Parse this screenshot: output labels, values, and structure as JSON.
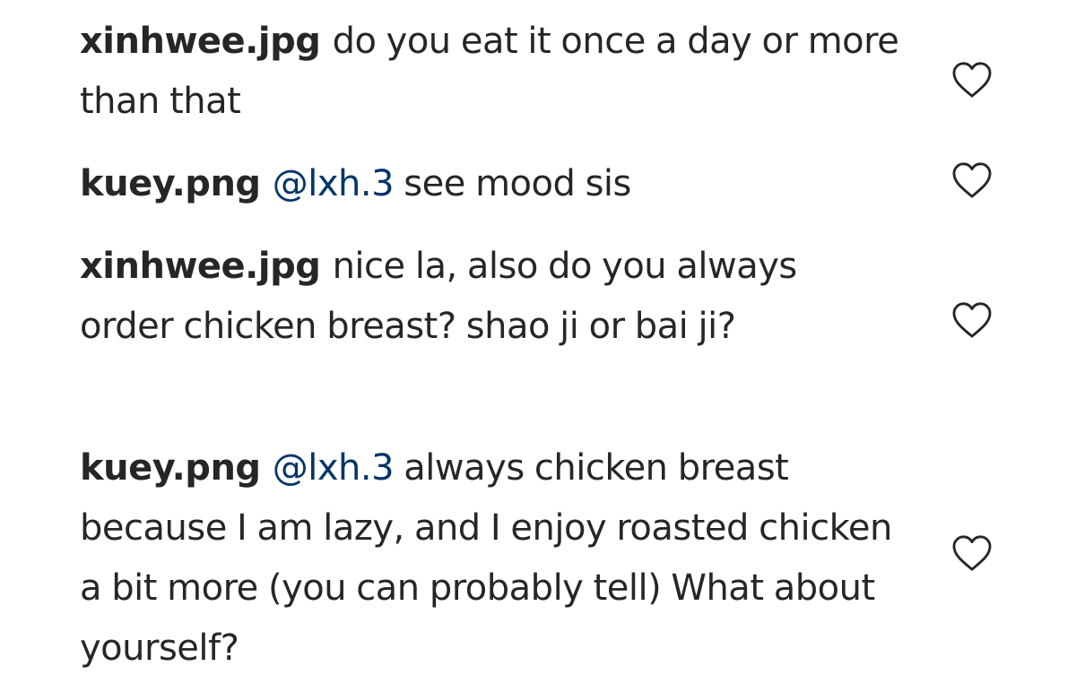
{
  "comments": [
    {
      "username": "xinhwee.jpg",
      "mention": "",
      "text": "do you eat it once a day or more than that",
      "like_icon": "heart-outline-icon"
    },
    {
      "username": "kuey.png",
      "mention": "@lxh.3",
      "text": "see mood sis",
      "like_icon": "heart-outline-icon"
    },
    {
      "username": "xinhwee.jpg",
      "mention": "",
      "text": "nice la, also do you always order chicken breast? shao ji or bai ji?",
      "like_icon": "heart-outline-icon"
    },
    {
      "username": "kuey.png",
      "mention": "@lxh.3",
      "text": "always chicken breast because I am lazy, and I enjoy roasted chicken a bit more (you can probably tell) What about yourself?",
      "like_icon": "heart-outline-icon"
    }
  ],
  "colors": {
    "text": "#262626",
    "mention": "#003569",
    "icon_stroke": "#262626",
    "background": "#ffffff"
  }
}
